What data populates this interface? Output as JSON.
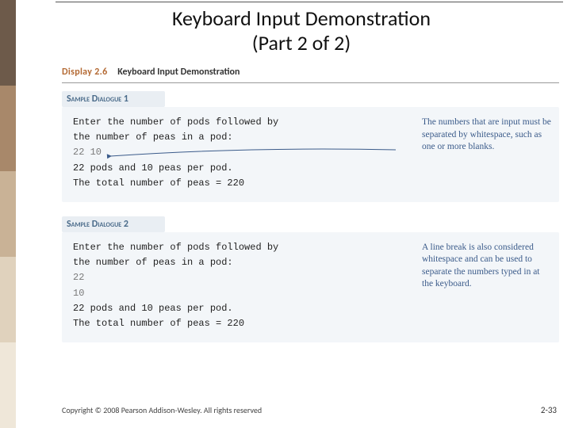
{
  "title_line1": "Keyboard Input Demonstration",
  "title_line2": "(Part 2 of 2)",
  "display": {
    "number": "Display 2.6",
    "title": "Keyboard Input Demonstration"
  },
  "samples": [
    {
      "label": "Sample Dialogue 1",
      "lines": [
        {
          "t": "Enter the number of pods followed by",
          "grey": false
        },
        {
          "t": "the number of peas in a pod:",
          "grey": false
        },
        {
          "t": "22 10",
          "grey": true
        },
        {
          "t": "22 pods and 10 peas per pod.",
          "grey": false
        },
        {
          "t": "The total number of peas = 220",
          "grey": false
        }
      ],
      "annotation": "The numbers that are input must be separated by whitespace, such as one or more blanks."
    },
    {
      "label": "Sample Dialogue 2",
      "lines": [
        {
          "t": "Enter the number of pods followed by",
          "grey": false
        },
        {
          "t": "the number of peas in a pod:",
          "grey": false
        },
        {
          "t": "22",
          "grey": true
        },
        {
          "t": "10",
          "grey": true
        },
        {
          "t": "22 pods and 10 peas per pod.",
          "grey": false
        },
        {
          "t": "The total number of peas = 220",
          "grey": false
        }
      ],
      "annotation": "A line break is also considered whitespace and can be used to separate the numbers typed in at the keyboard."
    }
  ],
  "footer": {
    "copyright": "Copyright © 2008 Pearson Addison-Wesley. All rights reserved",
    "page": "2-33"
  }
}
